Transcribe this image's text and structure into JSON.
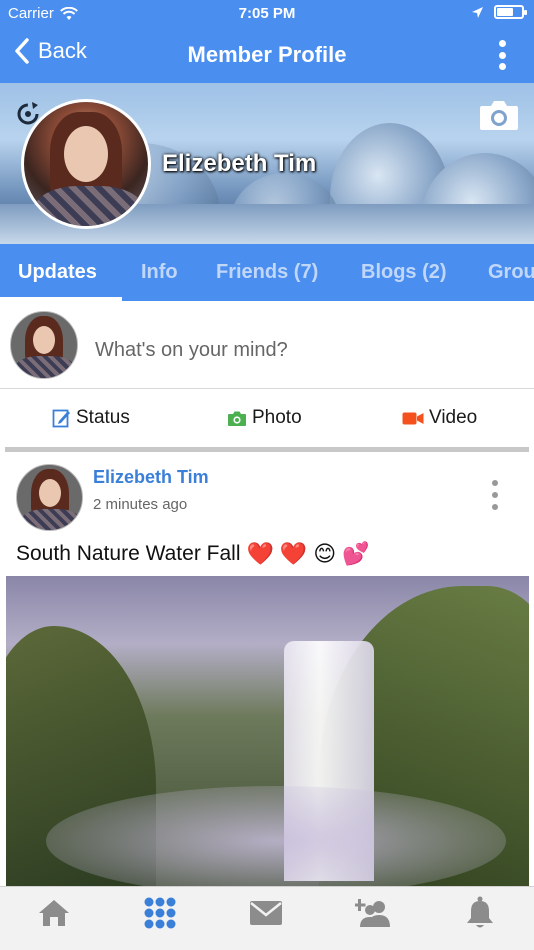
{
  "status_bar": {
    "carrier": "Carrier",
    "time": "7:05 PM"
  },
  "nav": {
    "back_label": "Back",
    "title": "Member Profile"
  },
  "profile": {
    "name": "Elizebeth Tim"
  },
  "tabs": [
    {
      "label": "Updates",
      "active": true
    },
    {
      "label": "Info"
    },
    {
      "label": "Friends (7)"
    },
    {
      "label": "Blogs (2)"
    },
    {
      "label": "Grou"
    }
  ],
  "composer": {
    "placeholder": "What's on your mind?",
    "actions": [
      {
        "label": "Status",
        "icon": "edit-icon",
        "color": "#3a7fd8"
      },
      {
        "label": "Photo",
        "icon": "camera-icon",
        "color": "#4caf50"
      },
      {
        "label": "Video",
        "icon": "video-icon",
        "color": "#f4511e"
      }
    ]
  },
  "post": {
    "author": "Elizebeth Tim",
    "time": "2 minutes ago",
    "text": "South Nature Water Fall",
    "emojis": [
      "❤️",
      "❤️",
      "😊",
      "💕"
    ]
  },
  "bottom_bar": {
    "items": [
      {
        "icon": "home-icon",
        "active": false
      },
      {
        "icon": "apps-grid-icon",
        "active": true
      },
      {
        "icon": "mail-icon",
        "active": false
      },
      {
        "icon": "add-friend-icon",
        "active": false
      },
      {
        "icon": "bell-icon",
        "active": false
      }
    ]
  },
  "colors": {
    "primary": "#4a8ef0",
    "link": "#3a7fd8",
    "inactive_icon": "#8c8c8c"
  }
}
